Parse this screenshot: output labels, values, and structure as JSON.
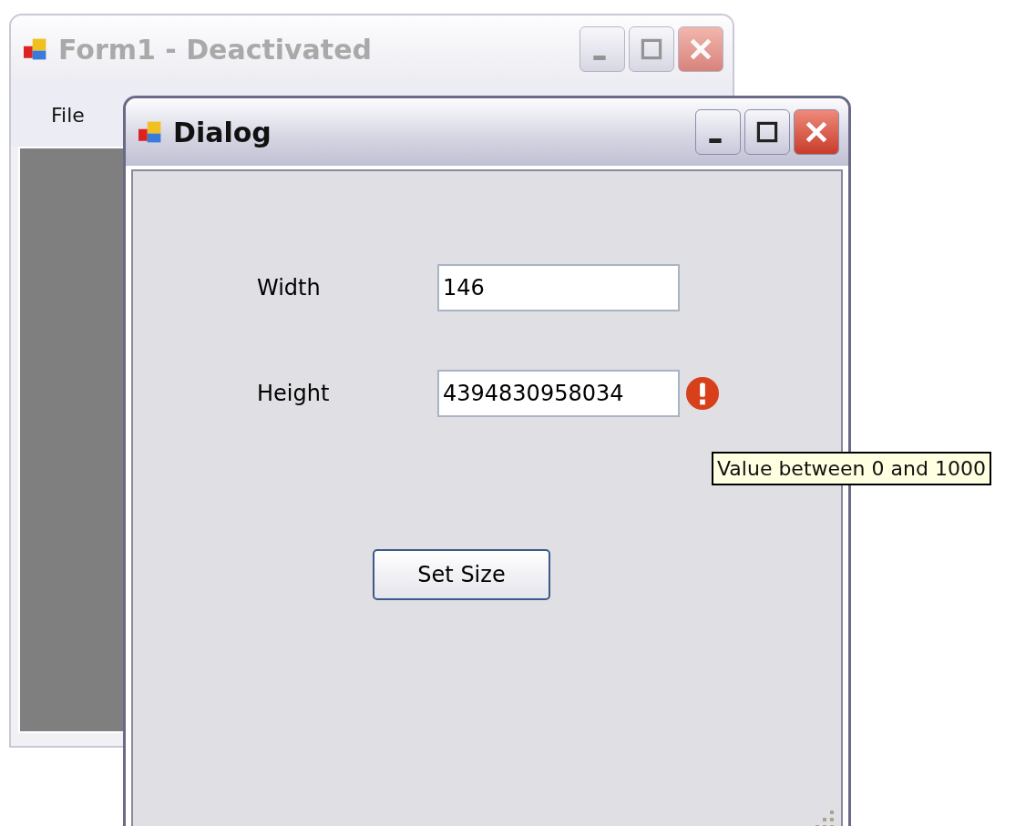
{
  "main_window": {
    "title": "Form1 - Deactivated",
    "active": false,
    "menu": [
      "File"
    ]
  },
  "dialog": {
    "title": "Dialog",
    "active": true,
    "button": "Set Size",
    "fields": [
      {
        "label": "Width",
        "value": "146",
        "error": false
      },
      {
        "label": "Height",
        "value": "4394830958034",
        "error": true
      }
    ]
  },
  "tooltip": {
    "text": "Value between 0 and 1000"
  }
}
